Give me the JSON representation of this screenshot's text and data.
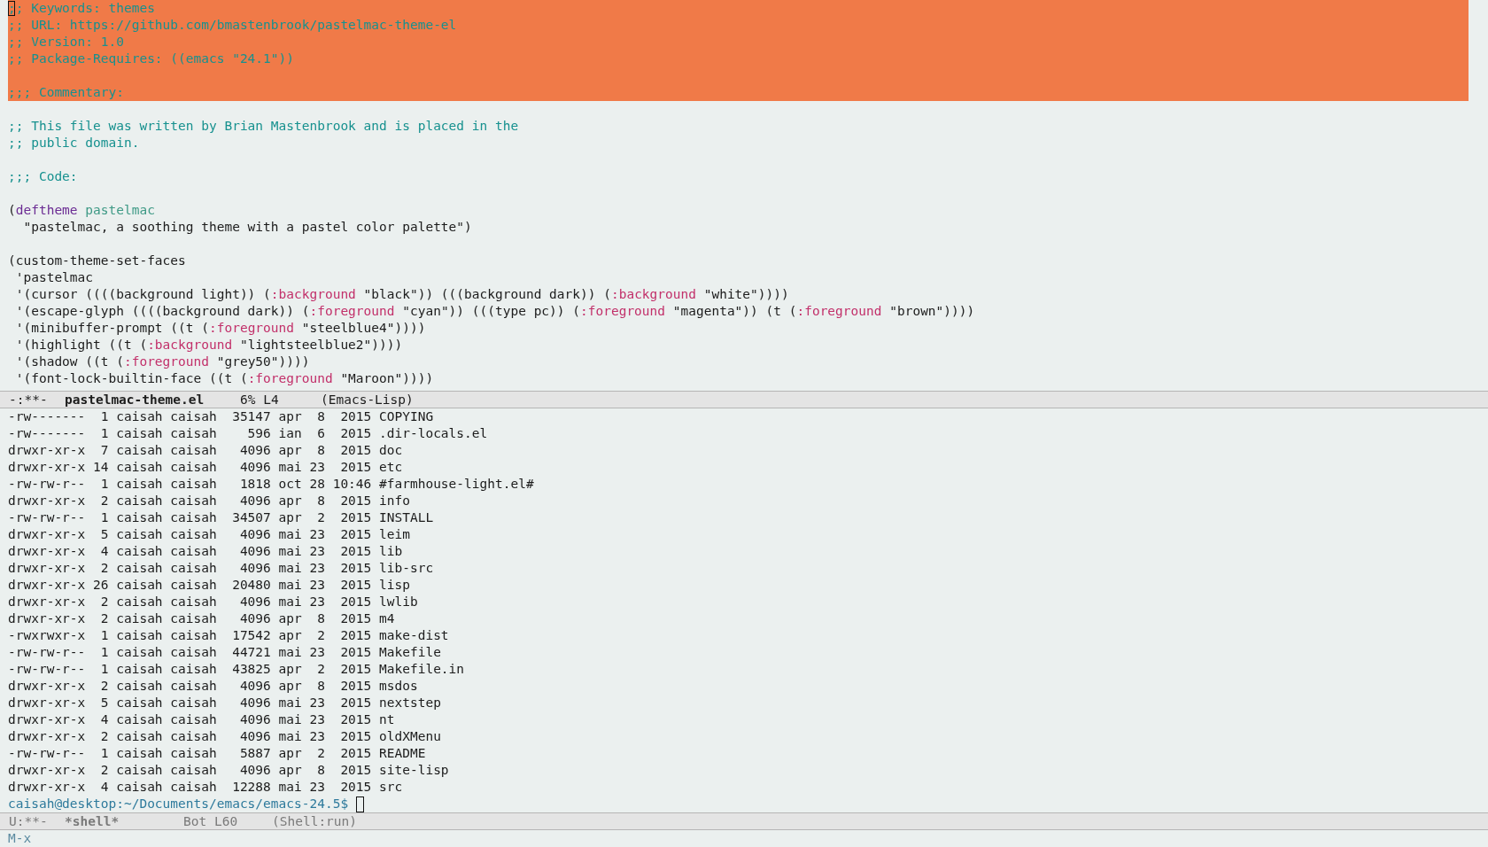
{
  "editor": {
    "lines": [
      {
        "kind": "code",
        "highlighted": true,
        "cursor": true,
        "segments": [
          {
            "kind": "comment",
            "text": ";; Keywords: themes"
          }
        ]
      },
      {
        "kind": "code",
        "highlighted": true,
        "cursor": false,
        "segments": [
          {
            "kind": "comment",
            "text": ";; URL: https://github.com/bmastenbrook/pastelmac-theme-el"
          }
        ]
      },
      {
        "kind": "code",
        "highlighted": true,
        "cursor": false,
        "segments": [
          {
            "kind": "comment",
            "text": ";; Version: 1.0"
          }
        ]
      },
      {
        "kind": "code",
        "highlighted": true,
        "cursor": false,
        "segments": [
          {
            "kind": "comment",
            "text": ";; Package-Requires: ((emacs \"24.1\"))"
          }
        ]
      },
      {
        "kind": "blank",
        "highlighted": true,
        "cursor": false
      },
      {
        "kind": "code",
        "highlighted": true,
        "cursor": false,
        "segments": [
          {
            "kind": "comment",
            "text": ";;; Commentary:"
          }
        ]
      },
      {
        "kind": "blank",
        "highlighted": false,
        "cursor": false
      },
      {
        "kind": "code",
        "highlighted": false,
        "cursor": false,
        "segments": [
          {
            "kind": "comment",
            "text": ";; This file was written by Brian Mastenbrook and is placed in the"
          }
        ]
      },
      {
        "kind": "code",
        "highlighted": false,
        "cursor": false,
        "segments": [
          {
            "kind": "comment",
            "text": ";; public domain."
          }
        ]
      },
      {
        "kind": "blank",
        "highlighted": false,
        "cursor": false
      },
      {
        "kind": "code",
        "highlighted": false,
        "cursor": false,
        "segments": [
          {
            "kind": "comment",
            "text": ";;; Code:"
          }
        ]
      },
      {
        "kind": "blank",
        "highlighted": false,
        "cursor": false
      },
      {
        "kind": "code",
        "highlighted": false,
        "cursor": false,
        "segments": [
          {
            "kind": "text",
            "text": "("
          },
          {
            "kind": "keyword",
            "text": "deftheme"
          },
          {
            "kind": "name",
            "text": " pastelmac"
          }
        ]
      },
      {
        "kind": "code",
        "highlighted": false,
        "cursor": false,
        "segments": [
          {
            "kind": "text",
            "text": "  \"pastelmac, a soothing theme with a pastel color palette\")"
          }
        ]
      },
      {
        "kind": "blank",
        "highlighted": false,
        "cursor": false
      },
      {
        "kind": "code",
        "highlighted": false,
        "cursor": false,
        "segments": [
          {
            "kind": "text",
            "text": "(custom-theme-set-faces"
          }
        ]
      },
      {
        "kind": "code",
        "highlighted": false,
        "cursor": false,
        "segments": [
          {
            "kind": "text",
            "text": " 'pastelmac"
          }
        ]
      },
      {
        "kind": "code",
        "highlighted": false,
        "cursor": false,
        "segments": [
          {
            "kind": "text",
            "text": " '(cursor ((((background light)) ("
          },
          {
            "kind": "property",
            "text": ":background"
          },
          {
            "kind": "text",
            "text": " \"black\")) (((background dark)) ("
          },
          {
            "kind": "property",
            "text": ":background"
          },
          {
            "kind": "text",
            "text": " \"white\"))))"
          }
        ]
      },
      {
        "kind": "code",
        "highlighted": false,
        "cursor": false,
        "segments": [
          {
            "kind": "text",
            "text": " '(escape-glyph ((((background dark)) ("
          },
          {
            "kind": "property",
            "text": ":foreground"
          },
          {
            "kind": "text",
            "text": " \"cyan\")) (((type pc)) ("
          },
          {
            "kind": "property",
            "text": ":foreground"
          },
          {
            "kind": "text",
            "text": " \"magenta\")) (t ("
          },
          {
            "kind": "property",
            "text": ":foreground"
          },
          {
            "kind": "text",
            "text": " \"brown\"))))"
          }
        ]
      },
      {
        "kind": "code",
        "highlighted": false,
        "cursor": false,
        "segments": [
          {
            "kind": "text",
            "text": " '(minibuffer-prompt ((t ("
          },
          {
            "kind": "property",
            "text": ":foreground"
          },
          {
            "kind": "text",
            "text": " \"steelblue4\"))))"
          }
        ]
      },
      {
        "kind": "code",
        "highlighted": false,
        "cursor": false,
        "segments": [
          {
            "kind": "text",
            "text": " '(highlight ((t ("
          },
          {
            "kind": "property",
            "text": ":background"
          },
          {
            "kind": "text",
            "text": " \"lightsteelblue2\"))))"
          }
        ]
      },
      {
        "kind": "code",
        "highlighted": false,
        "cursor": false,
        "segments": [
          {
            "kind": "text",
            "text": " '(shadow ((t ("
          },
          {
            "kind": "property",
            "text": ":foreground"
          },
          {
            "kind": "text",
            "text": " \"grey50\"))))"
          }
        ]
      },
      {
        "kind": "code",
        "highlighted": false,
        "cursor": false,
        "segments": [
          {
            "kind": "text",
            "text": " '(font-lock-builtin-face ((t ("
          },
          {
            "kind": "property",
            "text": ":foreground"
          },
          {
            "kind": "text",
            "text": " \"Maroon\"))))"
          }
        ]
      }
    ],
    "mode_line": {
      "active": true,
      "status": "-:**-",
      "buffer": "pastelmac-theme.el",
      "position": "6% L4",
      "mode": "(Emacs-Lisp)"
    }
  },
  "shell": {
    "lines": [
      "-rw-------  1 caisah caisah  35147 apr  8  2015 COPYING",
      "-rw-------  1 caisah caisah    596 ian  6  2015 .dir-locals.el",
      "drwxr-xr-x  7 caisah caisah   4096 apr  8  2015 doc",
      "drwxr-xr-x 14 caisah caisah   4096 mai 23  2015 etc",
      "-rw-rw-r--  1 caisah caisah   1818 oct 28 10:46 #farmhouse-light.el#",
      "drwxr-xr-x  2 caisah caisah   4096 apr  8  2015 info",
      "-rw-rw-r--  1 caisah caisah  34507 apr  2  2015 INSTALL",
      "drwxr-xr-x  5 caisah caisah   4096 mai 23  2015 leim",
      "drwxr-xr-x  4 caisah caisah   4096 mai 23  2015 lib",
      "drwxr-xr-x  2 caisah caisah   4096 mai 23  2015 lib-src",
      "drwxr-xr-x 26 caisah caisah  20480 mai 23  2015 lisp",
      "drwxr-xr-x  2 caisah caisah   4096 mai 23  2015 lwlib",
      "drwxr-xr-x  2 caisah caisah   4096 apr  8  2015 m4",
      "-rwxrwxr-x  1 caisah caisah  17542 apr  2  2015 make-dist",
      "-rw-rw-r--  1 caisah caisah  44721 mai 23  2015 Makefile",
      "-rw-rw-r--  1 caisah caisah  43825 apr  2  2015 Makefile.in",
      "drwxr-xr-x  2 caisah caisah   4096 apr  8  2015 msdos",
      "drwxr-xr-x  5 caisah caisah   4096 mai 23  2015 nextstep",
      "drwxr-xr-x  4 caisah caisah   4096 mai 23  2015 nt",
      "drwxr-xr-x  2 caisah caisah   4096 mai 23  2015 oldXMenu",
      "-rw-rw-r--  1 caisah caisah   5887 apr  2  2015 README",
      "drwxr-xr-x  2 caisah caisah   4096 apr  8  2015 site-lisp",
      "drwxr-xr-x  4 caisah caisah  12288 mai 23  2015 src"
    ],
    "prompt": "caisah@desktop:~/Documents/emacs/emacs-24.5$",
    "mode_line": {
      "active": false,
      "status": "U:**-",
      "buffer": "*shell*",
      "position": "Bot L60",
      "mode": "(Shell:run)"
    }
  },
  "minibuffer": {
    "text": "M-x"
  }
}
